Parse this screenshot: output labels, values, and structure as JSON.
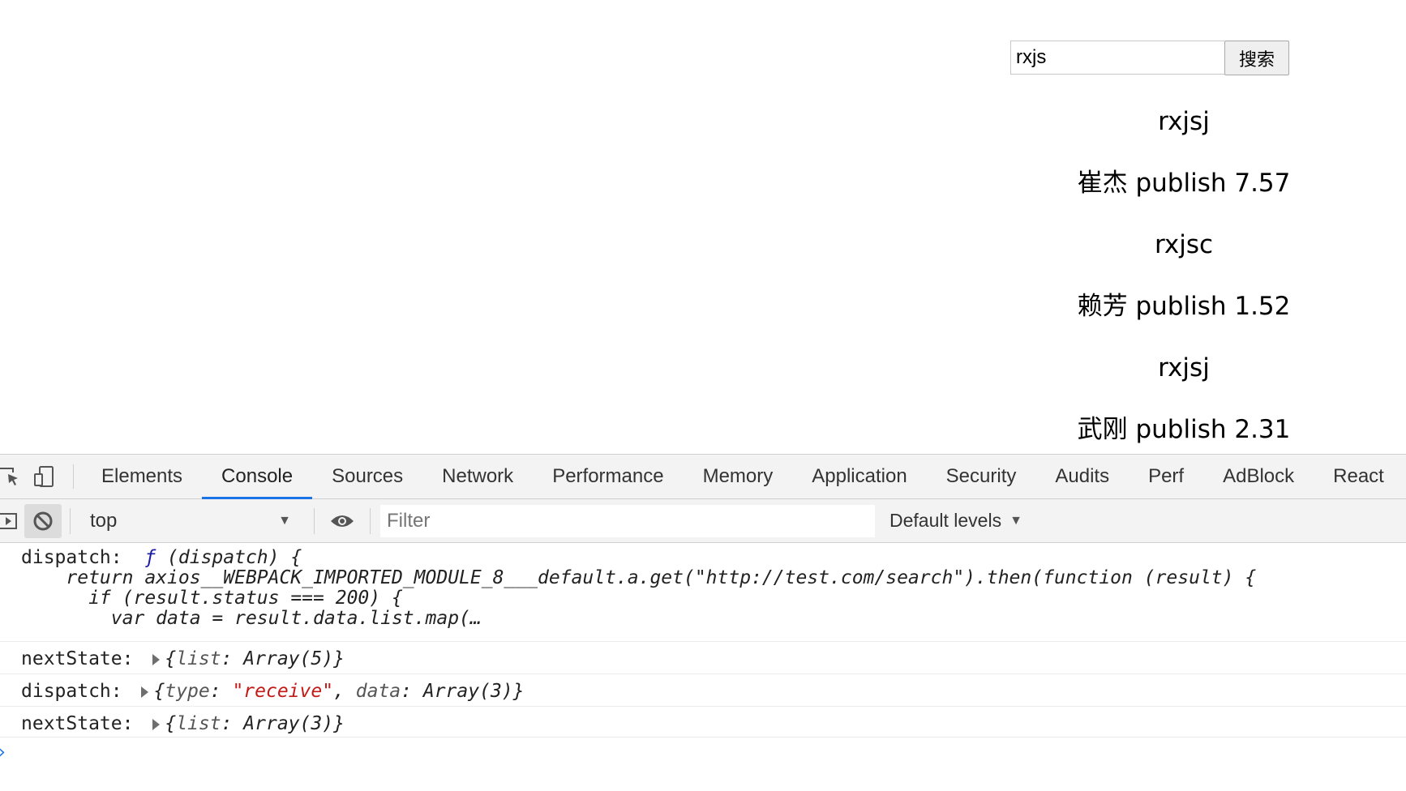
{
  "search": {
    "value": "rxjs",
    "button_label": "搜索"
  },
  "results": [
    "rxjsj",
    "崔杰 publish 7.57",
    "rxjsc",
    "赖芳 publish 1.52",
    "rxjsj",
    "武刚 publish 2.31"
  ],
  "devtools": {
    "tabs": [
      "Elements",
      "Console",
      "Sources",
      "Network",
      "Performance",
      "Memory",
      "Application",
      "Security",
      "Audits",
      "Perf",
      "AdBlock",
      "React"
    ],
    "active_tab": "Console",
    "toolbar": {
      "context": "top",
      "filter_placeholder": "Filter",
      "levels": "Default levels"
    },
    "console": {
      "msg1": {
        "label": "dispatch:",
        "fn_kw": "ƒ",
        "line1": " (dispatch) {",
        "line2": "    return axios__WEBPACK_IMPORTED_MODULE_8___default.a.get(\"http://test.com/search\").then(function (result) {",
        "line3": "      if (result.status === 200) {",
        "line4": "        var data = result.data.list.map(…"
      },
      "msg2": {
        "label": "nextState:",
        "open": "{",
        "key": "list",
        "colon": ": ",
        "value": "Array(5)",
        "close": "}"
      },
      "msg3": {
        "label": "dispatch:",
        "open": "{",
        "key1": "type",
        "colon": ": ",
        "str": "\"receive\"",
        "sep": ", ",
        "key2": "data",
        "value": "Array(3)",
        "close": "}"
      },
      "msg4": {
        "label": "nextState:",
        "open": "{",
        "key": "list",
        "colon": ": ",
        "value": "Array(3)",
        "close": "}"
      }
    }
  },
  "colors": {
    "accent": "#1a73e8",
    "string": "#c41a16",
    "keyword": "#1a1aa6"
  }
}
